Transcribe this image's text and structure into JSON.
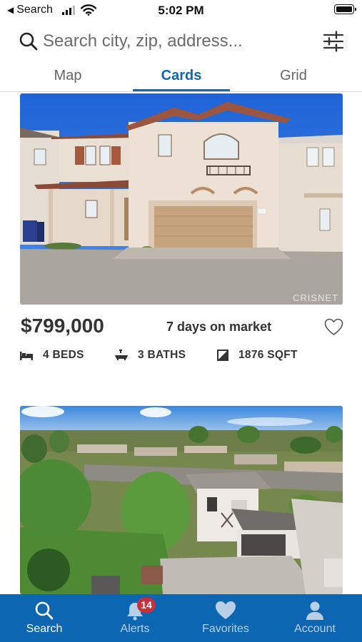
{
  "status_bar": {
    "back_label": "Search",
    "time": "5:02 PM",
    "back_icon": "back-triangle-icon",
    "signal_icon": "cellular-signal-icon",
    "wifi_icon": "wifi-icon",
    "battery_icon": "battery-icon"
  },
  "search": {
    "placeholder": "Search city, zip, address...",
    "value": "",
    "icon": "magnifier-icon",
    "filter_icon": "sliders-icon"
  },
  "tabs": [
    {
      "label": "Map",
      "active": false
    },
    {
      "label": "Cards",
      "active": true
    },
    {
      "label": "Grid",
      "active": false
    }
  ],
  "listings": [
    {
      "price": "$799,000",
      "days_on_market": "7 days on market",
      "beds": "4 BEDS",
      "baths": "3 BATHS",
      "sqft": "1876 SQFT",
      "watermark": "CRISNET",
      "favorite_icon": "heart-outline-icon"
    },
    {
      "price": "",
      "days_on_market": ""
    }
  ],
  "bottom_nav": {
    "items": [
      {
        "label": "Search",
        "icon": "search-icon",
        "active": true
      },
      {
        "label": "Alerts",
        "icon": "bell-icon",
        "active": false,
        "badge": "14"
      },
      {
        "label": "Favorites",
        "icon": "heart-icon",
        "active": false
      },
      {
        "label": "Account",
        "icon": "person-icon",
        "active": false
      }
    ]
  },
  "colors": {
    "accent": "#1366b5",
    "nav_background": "#0d66b2",
    "badge": "#c8313b",
    "inactive_tab": "#666666"
  }
}
